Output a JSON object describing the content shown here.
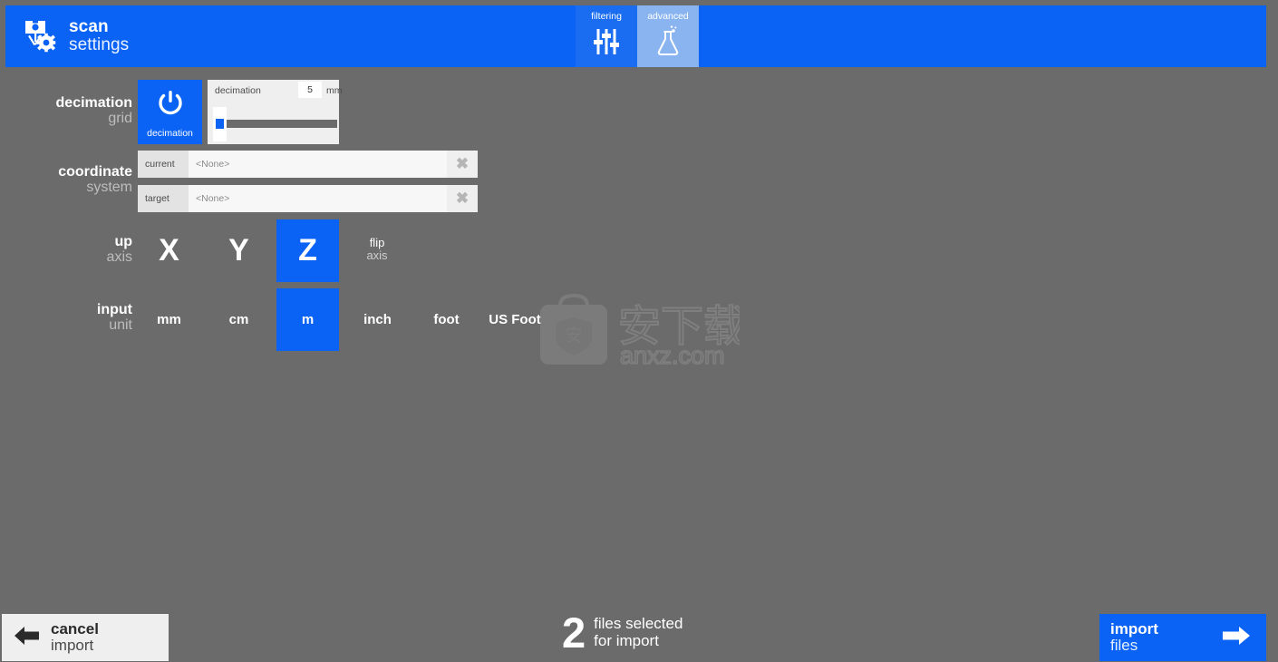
{
  "header": {
    "title_line1": "scan",
    "title_line2": "settings",
    "brand_icon": "scanner-gear-icon",
    "tabs": [
      {
        "label": "filtering",
        "icon": "sliders-icon",
        "active": false
      },
      {
        "label": "advanced",
        "icon": "flask-icon",
        "active": true
      }
    ]
  },
  "decimation": {
    "label_line1": "decimation",
    "label_line2": "grid",
    "toggle_label": "decimation",
    "toggle_icon": "power-icon",
    "toggle_on": true,
    "slider_name": "decimation",
    "slider_value": "5",
    "slider_unit": "mm"
  },
  "coordinate_system": {
    "label_line1": "coordinate",
    "label_line2": "system",
    "rows": [
      {
        "key": "current",
        "value": "<None>",
        "clear_icon": "close-icon"
      },
      {
        "key": "target",
        "value": "<None>",
        "clear_icon": "close-icon"
      }
    ]
  },
  "up_axis": {
    "label_line1": "up",
    "label_line2": "axis",
    "options": [
      {
        "label": "X",
        "selected": false
      },
      {
        "label": "Y",
        "selected": false
      },
      {
        "label": "Z",
        "selected": true
      }
    ],
    "flip_line1": "flip",
    "flip_line2": "axis"
  },
  "input_unit": {
    "label_line1": "input",
    "label_line2": "unit",
    "options": [
      {
        "label": "mm",
        "selected": false
      },
      {
        "label": "cm",
        "selected": false
      },
      {
        "label": "m",
        "selected": true
      },
      {
        "label": "inch",
        "selected": false
      },
      {
        "label": "foot",
        "selected": false
      },
      {
        "label": "US Foot",
        "selected": false
      }
    ]
  },
  "watermark": {
    "icon": "shield-bag-icon",
    "cjk_text": "安下载",
    "site": "anxz.com"
  },
  "footer": {
    "cancel_line1": "cancel",
    "cancel_line2": "import",
    "cancel_icon": "arrow-left-icon",
    "count": "2",
    "count_line1": "files selected",
    "count_line2": "for import",
    "import_line1": "import",
    "import_line2": "files",
    "import_icon": "arrow-right-icon"
  },
  "colors": {
    "background": "#6b6b6b",
    "accent": "#0a63f5",
    "accent_light": "#8ab4f0",
    "panel": "#efefef"
  }
}
